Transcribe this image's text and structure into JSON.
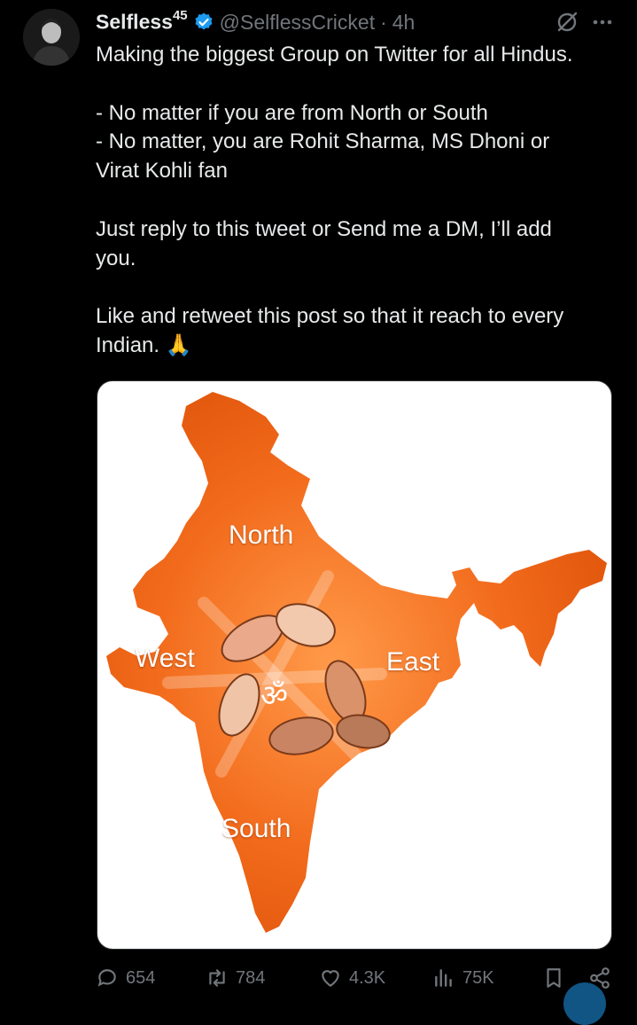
{
  "author": {
    "name": "Selfless",
    "name_suffix": "45",
    "handle": "@SelflessCricket",
    "separator": "·",
    "time": "4h",
    "verified": true
  },
  "tweet": {
    "text": "Making the biggest Group on Twitter for all Hindus.\n\n- No matter if you are from North or South\n- No matter, you are Rohit Sharma, MS Dhoni or\nVirat Kohli fan\n\nJust reply to this tweet or Send me a DM, I’ll add\nyou.\n\nLike and retweet this post so that it reach to every\nIndian. 🙏"
  },
  "media": {
    "labels": {
      "north": "North",
      "west": "West",
      "east": "East",
      "south": "South",
      "om": "ॐ"
    },
    "map_color": "#f26a1b"
  },
  "actions": {
    "replies": "654",
    "retweets": "784",
    "likes": "4.3K",
    "views": "75K"
  },
  "icons": [
    "avatar",
    "verified-badge-icon",
    "grok-icon",
    "more-icon",
    "reply-icon",
    "retweet-icon",
    "like-icon",
    "views-icon",
    "bookmark-icon",
    "share-icon"
  ],
  "colors": {
    "background": "#000000",
    "text": "#e7e9ea",
    "muted": "#71767b",
    "accent": "#1d9bf0"
  }
}
